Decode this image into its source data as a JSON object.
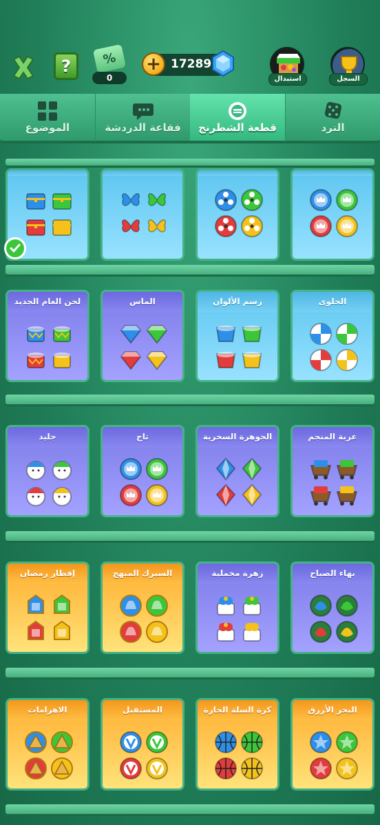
{
  "header": {
    "coupon_symbol": "%",
    "coupon_count": "0",
    "coins": "17289",
    "coin_plus": "+",
    "help_symbol": "?",
    "record_label": "السجل",
    "exchange_label": "استبدال"
  },
  "tabs": [
    {
      "label": "الموضوع",
      "icon": "theme-grid-icon",
      "active": false
    },
    {
      "label": "فقاعة الدردشة",
      "icon": "chat-bubble-icon",
      "active": false
    },
    {
      "label": "قطعة الشطرنج",
      "icon": "chess-piece-icon",
      "active": true
    },
    {
      "label": "النرد",
      "icon": "dice-icon",
      "active": false
    }
  ],
  "rows": [
    {
      "cards": [
        {
          "title": "",
          "style": "blue",
          "piece": "chest",
          "selected": true
        },
        {
          "title": "",
          "style": "blue",
          "piece": "butterfly",
          "selected": false
        },
        {
          "title": "",
          "style": "blue",
          "piece": "reel",
          "selected": false
        },
        {
          "title": "",
          "style": "blue",
          "piece": "token",
          "selected": false
        }
      ]
    },
    {
      "cards": [
        {
          "title": "لحن العام الجديد",
          "style": "purple",
          "piece": "drum"
        },
        {
          "title": "الماس",
          "style": "purple",
          "piece": "diamond"
        },
        {
          "title": "رسم الألوان",
          "style": "blue",
          "piece": "paintpot"
        },
        {
          "title": "الحلوى",
          "style": "blue",
          "piece": "candy"
        }
      ]
    },
    {
      "cards": [
        {
          "title": "جليد",
          "style": "purple",
          "piece": "snowman"
        },
        {
          "title": "تاج",
          "style": "purple",
          "piece": "crown"
        },
        {
          "title": "الجوهرة السحرية",
          "style": "purple",
          "piece": "crystal"
        },
        {
          "title": "عربة المنجم",
          "style": "purple",
          "piece": "cart"
        }
      ]
    },
    {
      "cards": [
        {
          "title": "إفطار رمضان",
          "style": "yellow",
          "piece": "lantern"
        },
        {
          "title": "السيرك المبهج",
          "style": "yellow",
          "piece": "circus"
        },
        {
          "title": "زهرة مخملية",
          "style": "purple",
          "piece": "flower"
        },
        {
          "title": "بهاء الصباح",
          "style": "purple",
          "piece": "morning"
        }
      ]
    },
    {
      "cards": [
        {
          "title": "الاهرامات",
          "style": "yellow",
          "piece": "pyramid"
        },
        {
          "title": "المستقبل",
          "style": "yellow",
          "piece": "future"
        },
        {
          "title": "كرة السلة الحارة",
          "style": "yellow",
          "piece": "basketball"
        },
        {
          "title": "البحر الأزرق",
          "style": "yellow",
          "piece": "starfish"
        }
      ]
    }
  ],
  "piece_colors": [
    "#2e8fe8",
    "#3cc63a",
    "#e23c3c",
    "#f4c21b"
  ]
}
